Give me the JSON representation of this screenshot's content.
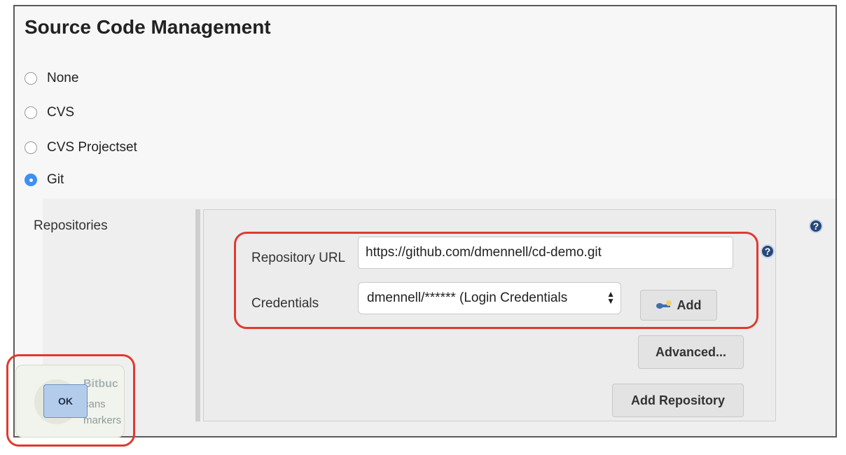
{
  "section": {
    "title": "Source Code Management"
  },
  "scm_options": [
    {
      "label": "None",
      "checked": false
    },
    {
      "label": "CVS",
      "checked": false
    },
    {
      "label": "CVS Projectset",
      "checked": false
    },
    {
      "label": "Git",
      "checked": true
    }
  ],
  "git": {
    "repositories_label": "Repositories",
    "repository_url_label": "Repository URL",
    "repository_url_value": "https://github.com/dmennell/cd-demo.git",
    "credentials_label": "Credentials",
    "credentials_value": "dmennell/****** (Login Credentials",
    "add_button_label": "Add",
    "advanced_button_label": "Advanced...",
    "add_repository_button_label": "Add Repository",
    "help_icon": "?"
  },
  "popup": {
    "title": "Bitbuc",
    "line1": "cans",
    "line2": "markers",
    "ok_label": "OK"
  },
  "colors": {
    "radio_selected": "#3d8ff5",
    "annotation_red": "#e03a2f",
    "help_icon_bg": "#26477a"
  }
}
